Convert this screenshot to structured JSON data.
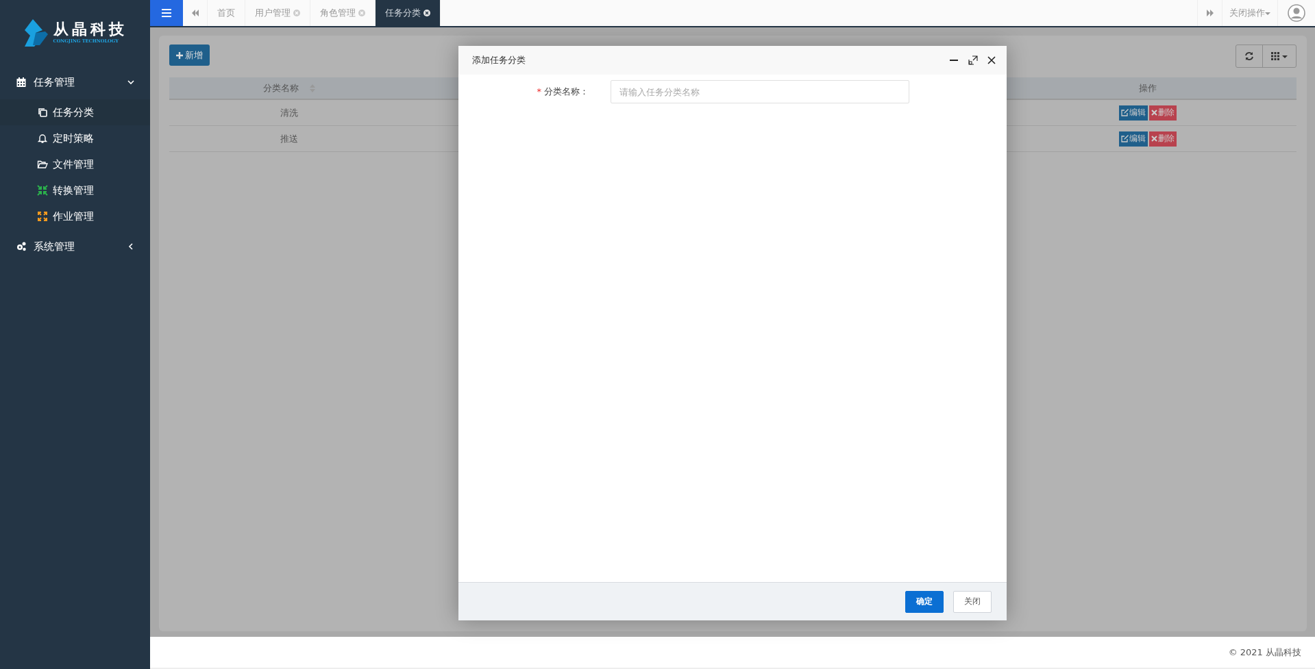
{
  "sidebar": {
    "logo": {
      "name": "从晶科技",
      "subtitle": "CONGJING TECHNOLOGY"
    },
    "menu": [
      {
        "label": "任务管理",
        "expanded": true,
        "children": [
          {
            "label": "任务分类",
            "selected": true
          },
          {
            "label": "定时策略",
            "selected": false
          },
          {
            "label": "文件管理",
            "selected": false
          },
          {
            "label": "转换管理",
            "selected": false
          },
          {
            "label": "作业管理",
            "selected": false
          }
        ]
      },
      {
        "label": "系统管理",
        "expanded": false
      }
    ]
  },
  "tabs": [
    {
      "label": "首页",
      "closable": false,
      "selected": false
    },
    {
      "label": "用户管理",
      "closable": true,
      "selected": false
    },
    {
      "label": "角色管理",
      "closable": true,
      "selected": false
    },
    {
      "label": "任务分类",
      "closable": true,
      "selected": true
    }
  ],
  "top_actions": {
    "close_menu": "关闭操作"
  },
  "toolbar": {
    "add": "新增"
  },
  "table": {
    "columns": [
      "分类名称",
      "操作"
    ],
    "rows": [
      {
        "name": "清洗",
        "edit": "编辑",
        "delete": "删除"
      },
      {
        "name": "推送",
        "edit": "编辑",
        "delete": "删除"
      }
    ]
  },
  "dialog": {
    "title": "添加任务分类",
    "field": {
      "label": "分类名称：",
      "required": "*",
      "placeholder": "请输入任务分类名称"
    },
    "buttons": [
      {
        "label": "确定",
        "kind": "primary"
      },
      {
        "label": "关闭",
        "kind": "default"
      }
    ]
  },
  "footer": "© 2021 从晶科技"
}
